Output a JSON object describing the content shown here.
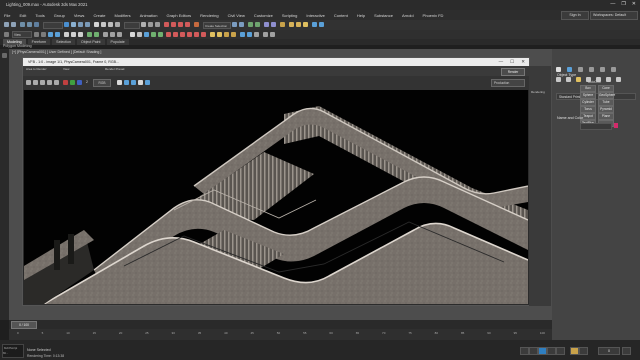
{
  "app": {
    "title": "Lighting_009.max - Autodesk 3ds Max 2021",
    "window_controls": [
      "—",
      "❐",
      "✕"
    ]
  },
  "menu": {
    "items": [
      "File",
      "Edit",
      "Tools",
      "Group",
      "Views",
      "Create",
      "Modifiers",
      "Animation",
      "Graph Editors",
      "Rendering",
      "Civil View",
      "Customize",
      "Scripting",
      "Interactive",
      "Content",
      "Help",
      "Substance",
      "Arnold",
      "Phoenix FD"
    ],
    "signin": "Sign In",
    "workspaces": "Workspaces: Default"
  },
  "toolbar": {
    "view_dropdown": "View",
    "create_selection_set": "Create Selection Se"
  },
  "ribbon": {
    "tabs": [
      "Modeling",
      "Freeform",
      "Selection",
      "Object Paint",
      "Populate"
    ],
    "active": "Modeling",
    "sublabel": "Polygon Modeling"
  },
  "viewport": {
    "label": "[+] [PhysCamera001] [ User Defined ] [Default Shading ]"
  },
  "vfb": {
    "title": "VFB - 1:0 - image 1/1, PhysCamera001, Frame 0, RGB...",
    "window_controls": [
      "—",
      "☐",
      "✕"
    ],
    "tb_area_to_render": "Area to Render:",
    "tb_view": "View",
    "tb_preset": "Render Preset:",
    "tb_render_button": "Render",
    "tb_production": "Production",
    "tb_channel": "RGB",
    "tb_zoom": "2",
    "status_label": "Rendering"
  },
  "command_panel": {
    "std_primitives": "Standard Primitives",
    "object_type_header": "Object Type",
    "autogrid": "AutoGrid",
    "buttons": [
      "Box",
      "Cone",
      "Sphere",
      "GeoSphere",
      "Cylinder",
      "Tube",
      "Torus",
      "Pyramid",
      "Teapot",
      "Plane",
      "TextPlus",
      ""
    ],
    "name_color_header": "Name and Color",
    "accent_color": "#d42a6a"
  },
  "timeline": {
    "frame": "0 / 100",
    "ticks": [
      "0",
      "5",
      "10",
      "15",
      "20",
      "25",
      "30",
      "35",
      "40",
      "45",
      "50",
      "55",
      "60",
      "65",
      "70",
      "75",
      "80",
      "85",
      "90",
      "95",
      "100"
    ]
  },
  "statusbar": {
    "selection": "None Selected",
    "time": "Rendering Time: 0:13:38",
    "maxscript": "MAXScript Mi..."
  },
  "icons": [
    "undo-icon",
    "redo-icon",
    "link-icon",
    "unlink-icon",
    "select-icon",
    "move-icon",
    "rotate-icon",
    "scale-icon",
    "render-icon",
    "camera-icon",
    "play-icon",
    "stop-icon"
  ],
  "colors": {
    "bg_dark": "#1f1f1f",
    "panel": "#444444",
    "viewport": "#4d4d4d",
    "accent_pink": "#d42a6a",
    "accent_blue": "#2f7fc1"
  }
}
